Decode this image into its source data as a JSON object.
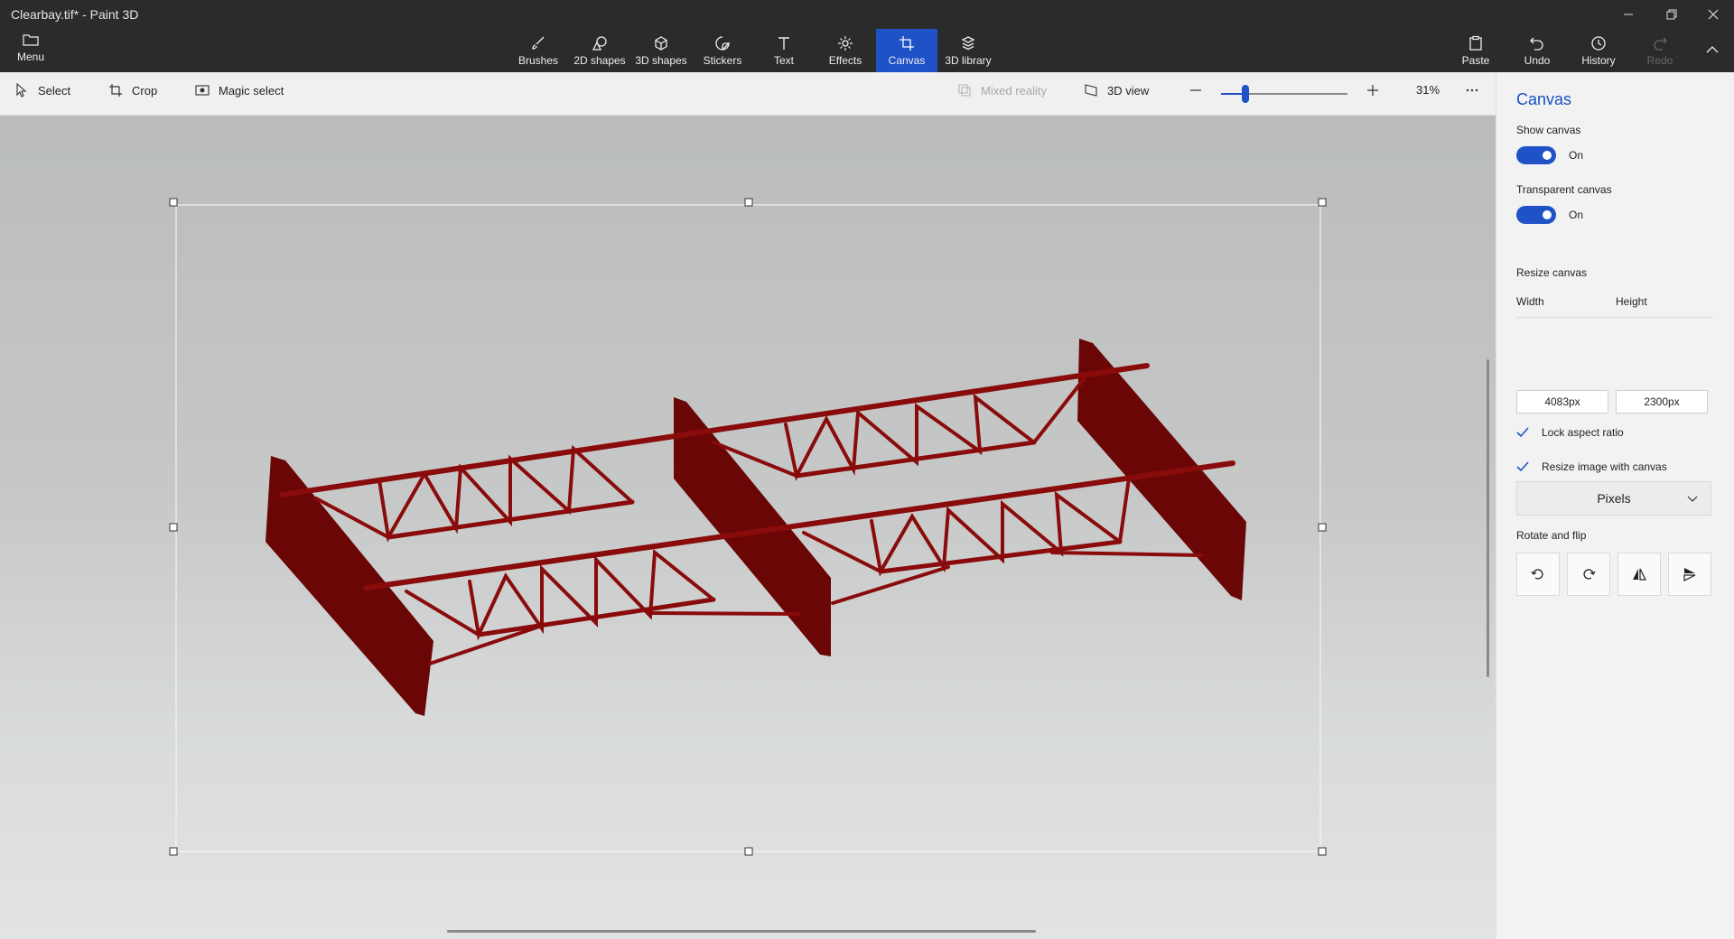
{
  "window": {
    "title": "Clearbay.tif* - Paint 3D"
  },
  "menu": {
    "label": "Menu"
  },
  "ribbon": {
    "tools": [
      {
        "label": "Brushes",
        "icon": "brush-icon"
      },
      {
        "label": "2D shapes",
        "icon": "2d-shapes-icon"
      },
      {
        "label": "3D shapes",
        "icon": "3d-shapes-icon"
      },
      {
        "label": "Stickers",
        "icon": "sticker-icon"
      },
      {
        "label": "Text",
        "icon": "text-icon"
      },
      {
        "label": "Effects",
        "icon": "effects-icon"
      },
      {
        "label": "Canvas",
        "icon": "canvas-icon",
        "active": true
      },
      {
        "label": "3D library",
        "icon": "3d-library-icon"
      }
    ],
    "right": [
      {
        "label": "Paste",
        "icon": "paste-icon"
      },
      {
        "label": "Undo",
        "icon": "undo-icon"
      },
      {
        "label": "History",
        "icon": "history-icon"
      },
      {
        "label": "Redo",
        "icon": "redo-icon",
        "disabled": true
      }
    ]
  },
  "toolbar": {
    "select": "Select",
    "crop": "Crop",
    "magic_select": "Magic select",
    "mixed_reality": "Mixed reality",
    "view_3d": "3D view",
    "zoom_percent": "31%",
    "zoom_level": 0.31
  },
  "panel": {
    "title": "Canvas",
    "show_canvas_label": "Show canvas",
    "show_canvas_state": "On",
    "transparent_label": "Transparent canvas",
    "transparent_state": "On",
    "resize_label": "Resize canvas",
    "width_label": "Width",
    "height_label": "Height",
    "width_value": "4083px",
    "height_value": "2300px",
    "lock_aspect": "Lock aspect ratio",
    "resize_with_canvas": "Resize image with canvas",
    "units": "Pixels",
    "rotate_flip_label": "Rotate and flip"
  },
  "colors": {
    "accent": "#1f52c7",
    "truss": "#8a0b0b"
  }
}
